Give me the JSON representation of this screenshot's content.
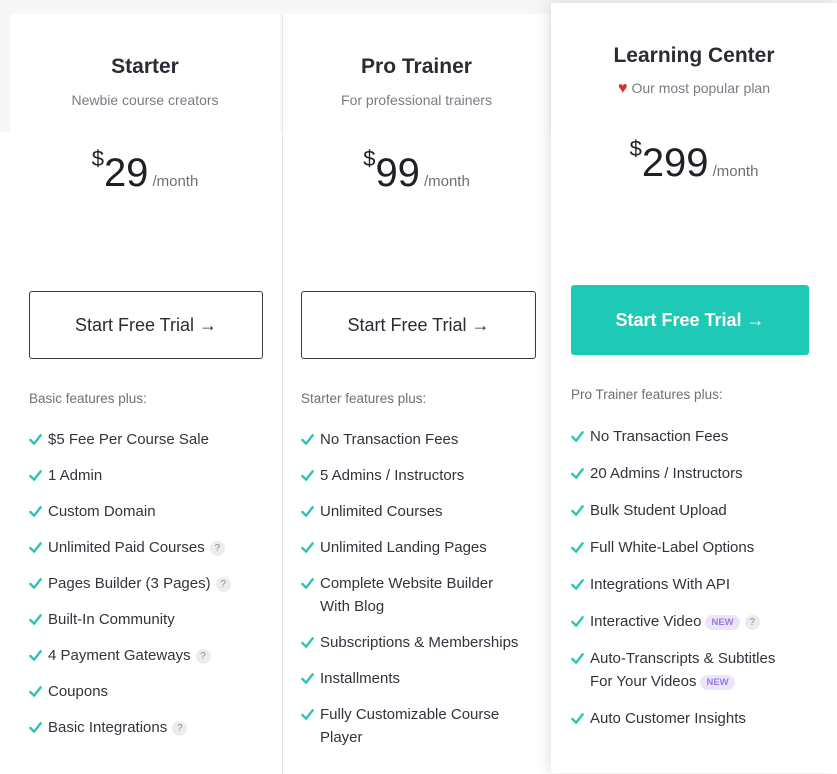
{
  "colors": {
    "accent": "#1ecab5",
    "check": "#2ec4b6",
    "heart": "#d0342c",
    "new_badge": "#9b7be0"
  },
  "plans": [
    {
      "name": "Starter",
      "subtitle": "Newbie course creators",
      "currency": "$",
      "price": "29",
      "period": "/month",
      "cta": "Start Free Trial →",
      "features_heading": "Basic features plus:",
      "features": [
        {
          "text": "$5 Fee Per Course Sale"
        },
        {
          "text": "1 Admin"
        },
        {
          "text": "Custom Domain"
        },
        {
          "text": "Unlimited Paid Courses",
          "help": "?"
        },
        {
          "text": "Pages Builder (3 Pages)",
          "help": "?"
        },
        {
          "text": "Built-In Community"
        },
        {
          "text": "4 Payment Gateways",
          "help": "?"
        },
        {
          "text": "Coupons"
        },
        {
          "text": "Basic Integrations",
          "help": "?"
        }
      ]
    },
    {
      "name": "Pro Trainer",
      "subtitle": "For professional trainers",
      "currency": "$",
      "price": "99",
      "period": "/month",
      "cta": "Start Free Trial →",
      "features_heading": "Starter features plus:",
      "features": [
        {
          "text": "No Transaction Fees"
        },
        {
          "text": "5 Admins / Instructors"
        },
        {
          "text": "Unlimited Courses"
        },
        {
          "text": "Unlimited Landing Pages"
        },
        {
          "text_line1": "Complete Website Builder",
          "text_line2": "With Blog"
        },
        {
          "text": "Subscriptions & Memberships"
        },
        {
          "text": "Installments"
        },
        {
          "text_line1": "Fully Customizable Course",
          "text_line2": "Player"
        }
      ]
    },
    {
      "name": "Learning Center",
      "subtitle": "Our most popular plan",
      "currency": "$",
      "price": "299",
      "period": "/month",
      "cta": "Start Free Trial →",
      "features_heading": "Pro Trainer features plus:",
      "features": [
        {
          "text": "No Transaction Fees"
        },
        {
          "text": "20 Admins / Instructors"
        },
        {
          "text": "Bulk Student Upload"
        },
        {
          "text": "Full White-Label Options"
        },
        {
          "text": "Integrations With API"
        },
        {
          "text": "Interactive Video",
          "badge": "NEW",
          "help": "?"
        },
        {
          "text_line1": "Auto-Transcripts & Subtitles",
          "text_line2": "For Your Videos",
          "badge": "NEW"
        },
        {
          "text": "Auto Customer Insights"
        }
      ]
    }
  ]
}
